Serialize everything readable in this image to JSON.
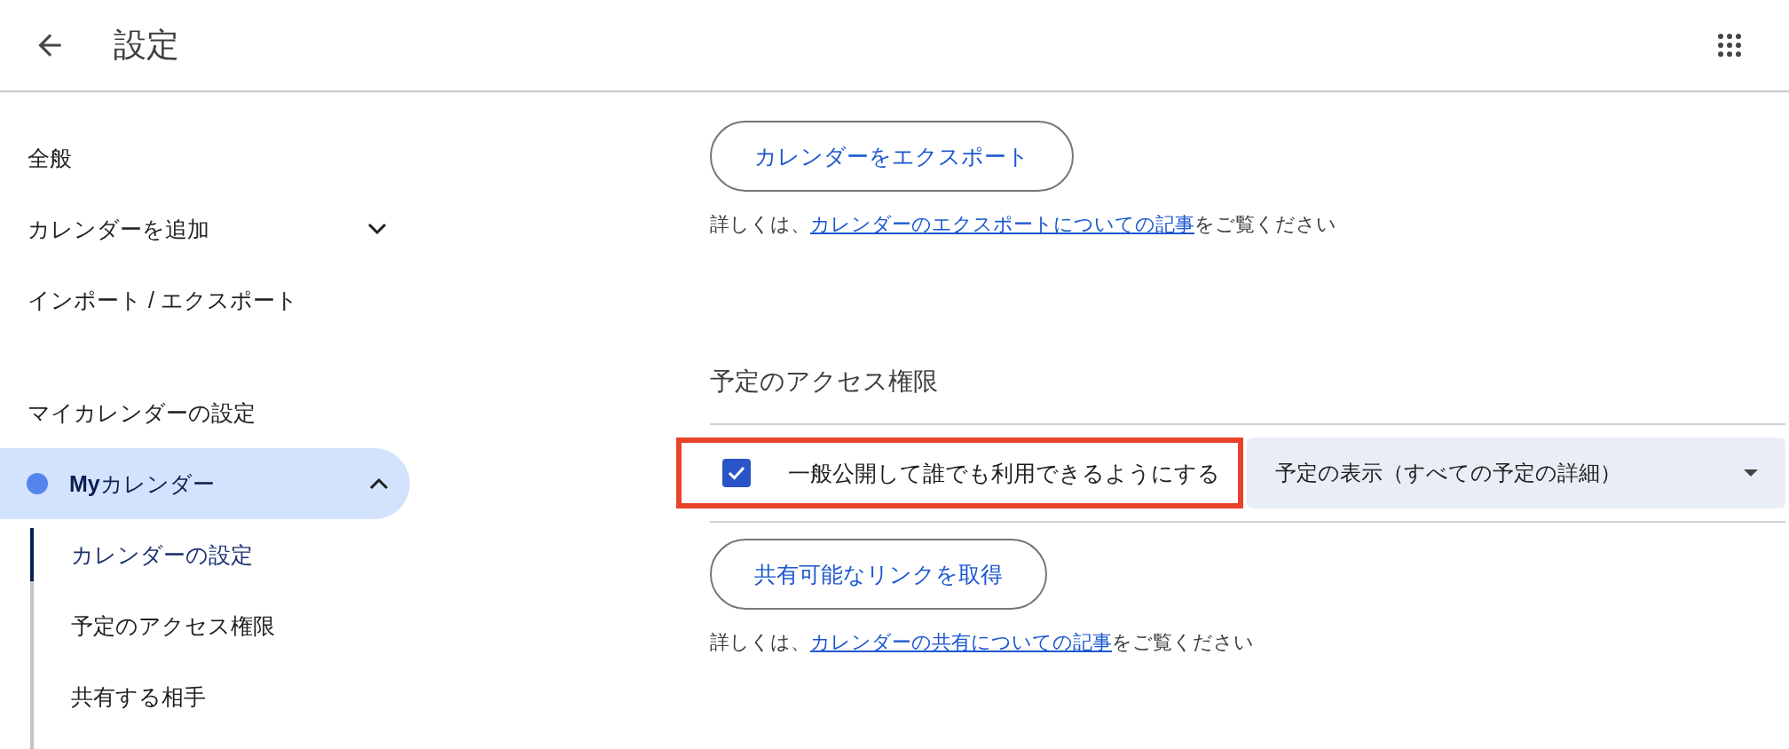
{
  "header": {
    "title": "設定"
  },
  "sidebar": {
    "items": [
      {
        "label": "全般",
        "kind": "link"
      },
      {
        "label": "カレンダーを追加",
        "kind": "expander",
        "expanded": false
      },
      {
        "label": "インポート / エクスポート",
        "kind": "link"
      },
      {
        "label": "マイカレンダーの設定",
        "kind": "heading"
      }
    ],
    "calendars": [
      {
        "name": "**My**カレンダー",
        "color": "#5484ed",
        "selected": true,
        "expanded": true,
        "children": [
          {
            "label": "カレンダーの設定",
            "selected": true
          },
          {
            "label": "予定のアクセス権限",
            "selected": false
          },
          {
            "label": "共有する相手",
            "selected": false
          }
        ]
      }
    ]
  },
  "export": {
    "button": "カレンダーをエクスポート",
    "help": {
      "prefix": "詳しくは、",
      "link": "カレンダーのエクスポートについての記事",
      "suffix": "をご覧ください"
    }
  },
  "access": {
    "title": "予定のアクセス権限",
    "public": {
      "label": "一般公開して誰でも利用できるようにする",
      "checked": true,
      "highlighted": true
    },
    "visibility": {
      "value": "予定の表示（すべての予定の詳細）"
    },
    "button": "共有可能なリンクを取得",
    "help": {
      "prefix": "詳しくは、",
      "link": "カレンダーの共有についての記事",
      "suffix": "をご覧ください"
    }
  }
}
